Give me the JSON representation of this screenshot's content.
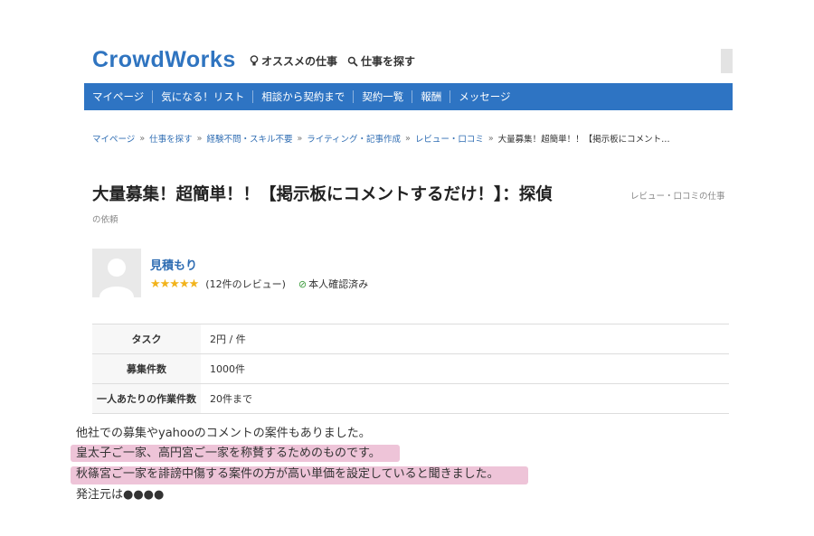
{
  "header": {
    "logo": "CrowdWorks",
    "recommended_label": "オススメの仕事",
    "search_label": "仕事を探す"
  },
  "nav": {
    "items": [
      "マイページ",
      "気になる！リスト",
      "相談から契約まで",
      "契約一覧",
      "報酬",
      "メッセージ"
    ]
  },
  "breadcrumb": {
    "items": [
      "マイページ",
      "仕事を探す",
      "経験不問・スキル不要",
      "ライティング・記事作成",
      "レビュー・口コミ"
    ],
    "current": "大量募集！超簡単！！【掲示板にコメント…",
    "separator": "»"
  },
  "job": {
    "title": "大量募集！超簡単！！【掲示板にコメントするだけ！】：探偵",
    "category_line1": "レビュー・口コミの仕事",
    "category_line2": "の依頼"
  },
  "client": {
    "name": "見積もり",
    "stars": "★★★★★",
    "rating": 5,
    "review_count": "(12件のレビュー)",
    "verified": "本人確認済み"
  },
  "details": [
    {
      "label": "タスク",
      "value": "2円 / 件"
    },
    {
      "label": "募集件数",
      "value": "1000件"
    },
    {
      "label": "一人あたりの作業件数",
      "value": "20件まで"
    }
  ],
  "comments": [
    "他社での募集やyahooのコメントの案件もありました。",
    "皇太子ご一家、高円宮ご一家を称賛するためのものです。",
    "秋篠宮ご一家を誹謗中傷する案件の方が高い単価を設定していると聞きました。",
    "発注元は●●●●"
  ],
  "colors": {
    "brand": "#2f74c0",
    "nav_bg": "#2e74c3",
    "highlight": "#eec4d8",
    "star": "#f2b31b"
  }
}
